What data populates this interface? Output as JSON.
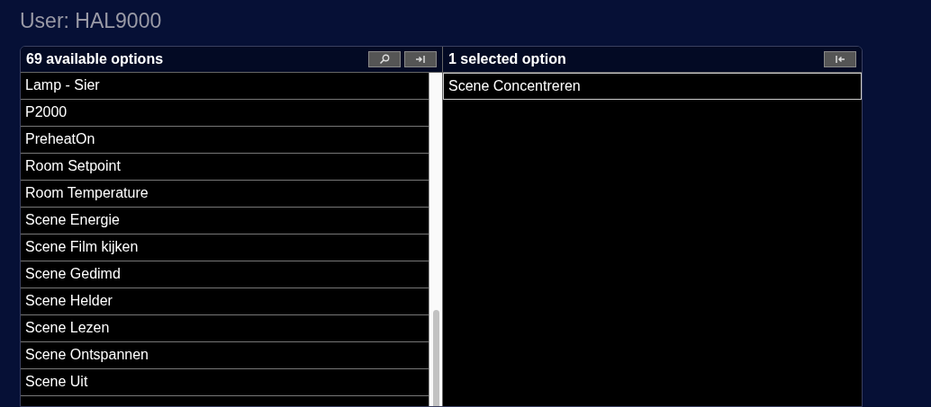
{
  "title": "User: HAL9000",
  "available": {
    "heading": "69 available options",
    "items": [
      "Lamp - Sier",
      "P2000",
      "PreheatOn",
      "Room Setpoint",
      "Room Temperature",
      "Scene Energie",
      "Scene Film kijken",
      "Scene Gedimd",
      "Scene Helder",
      "Scene Lezen",
      "Scene Ontspannen",
      "Scene Uit"
    ]
  },
  "selected": {
    "heading": "1 selected option",
    "items": [
      "Scene Concentreren"
    ]
  }
}
